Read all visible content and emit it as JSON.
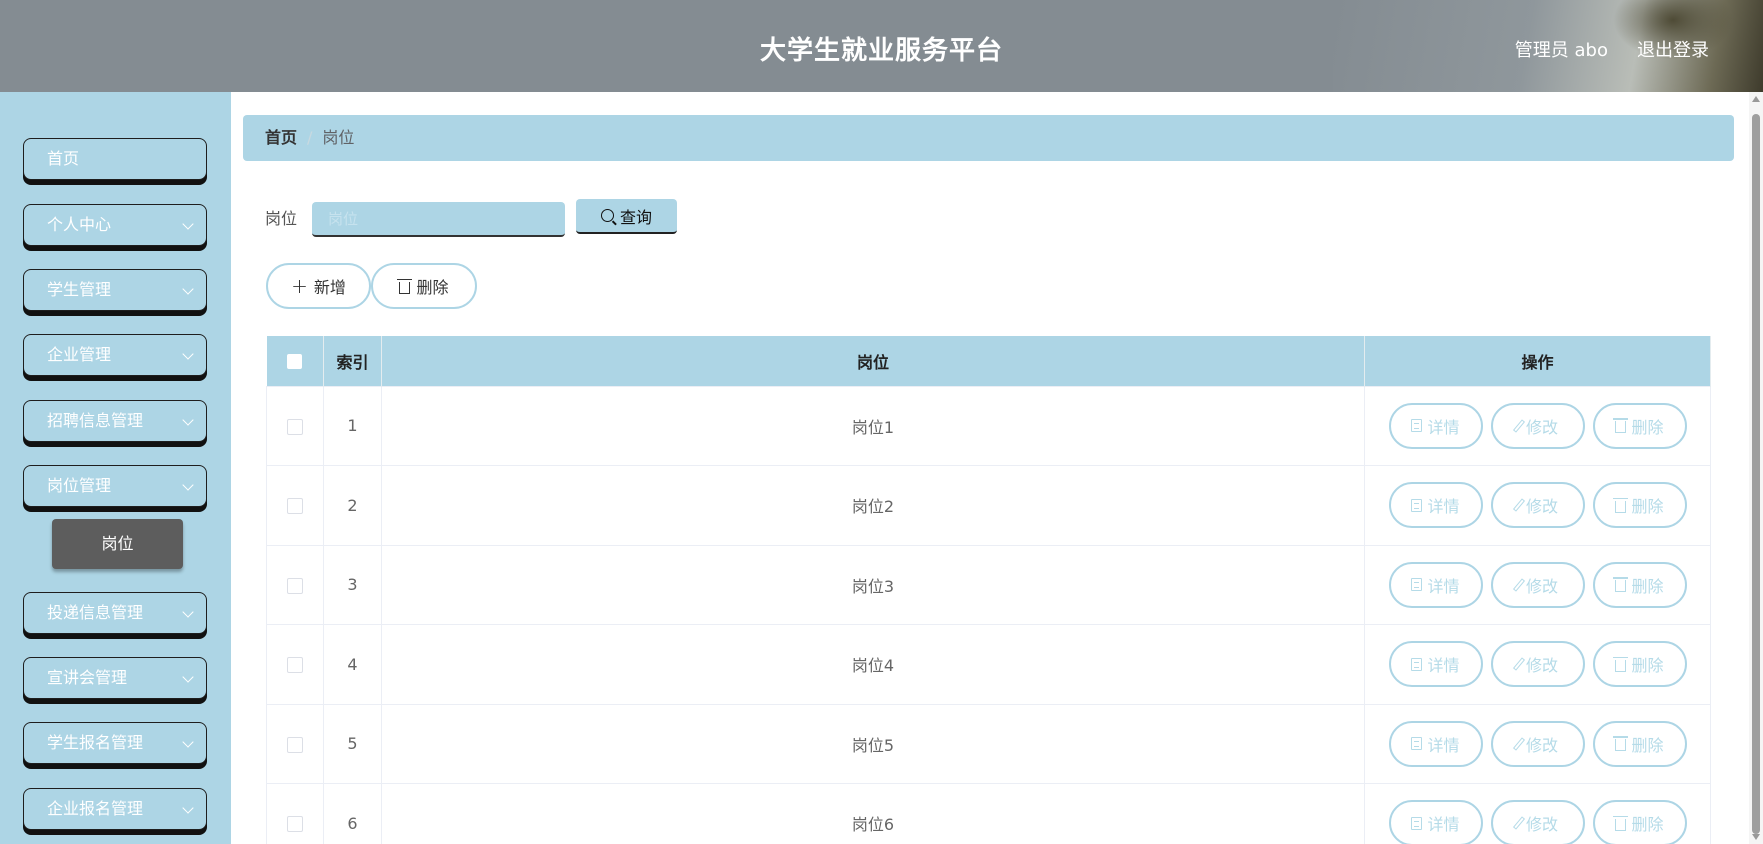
{
  "header": {
    "title": "大学生就业服务平台",
    "user": "管理员 abo",
    "logout": "退出登录"
  },
  "sidebar": {
    "items": [
      {
        "label": "首页",
        "has_chevron": false
      },
      {
        "label": "个人中心",
        "has_chevron": true
      },
      {
        "label": "学生管理",
        "has_chevron": true
      },
      {
        "label": "企业管理",
        "has_chevron": true
      },
      {
        "label": "招聘信息管理",
        "has_chevron": true
      },
      {
        "label": "岗位管理",
        "has_chevron": true
      },
      {
        "label": "投递信息管理",
        "has_chevron": true
      },
      {
        "label": "宣讲会管理",
        "has_chevron": true
      },
      {
        "label": "学生报名管理",
        "has_chevron": true
      },
      {
        "label": "企业报名管理",
        "has_chevron": true
      }
    ],
    "subitem": "岗位"
  },
  "breadcrumb": {
    "home": "首页",
    "separator": "/",
    "current": "岗位"
  },
  "search": {
    "label": "岗位",
    "placeholder": "岗位",
    "button": "查询"
  },
  "actions": {
    "add": "新增",
    "delete": "删除"
  },
  "table": {
    "headers": {
      "index": "索引",
      "position": "岗位",
      "operation": "操作"
    },
    "rows": [
      {
        "index": "1",
        "position": "岗位1"
      },
      {
        "index": "2",
        "position": "岗位2"
      },
      {
        "index": "3",
        "position": "岗位3"
      },
      {
        "index": "4",
        "position": "岗位4"
      },
      {
        "index": "5",
        "position": "岗位5"
      },
      {
        "index": "6",
        "position": "岗位6"
      }
    ],
    "row_actions": {
      "detail": "详情",
      "edit": "修改",
      "delete": "删除"
    }
  },
  "colors": {
    "accent": "#add5e5",
    "header_bg": "#848c92",
    "submenu_active": "#5d5d5d"
  }
}
